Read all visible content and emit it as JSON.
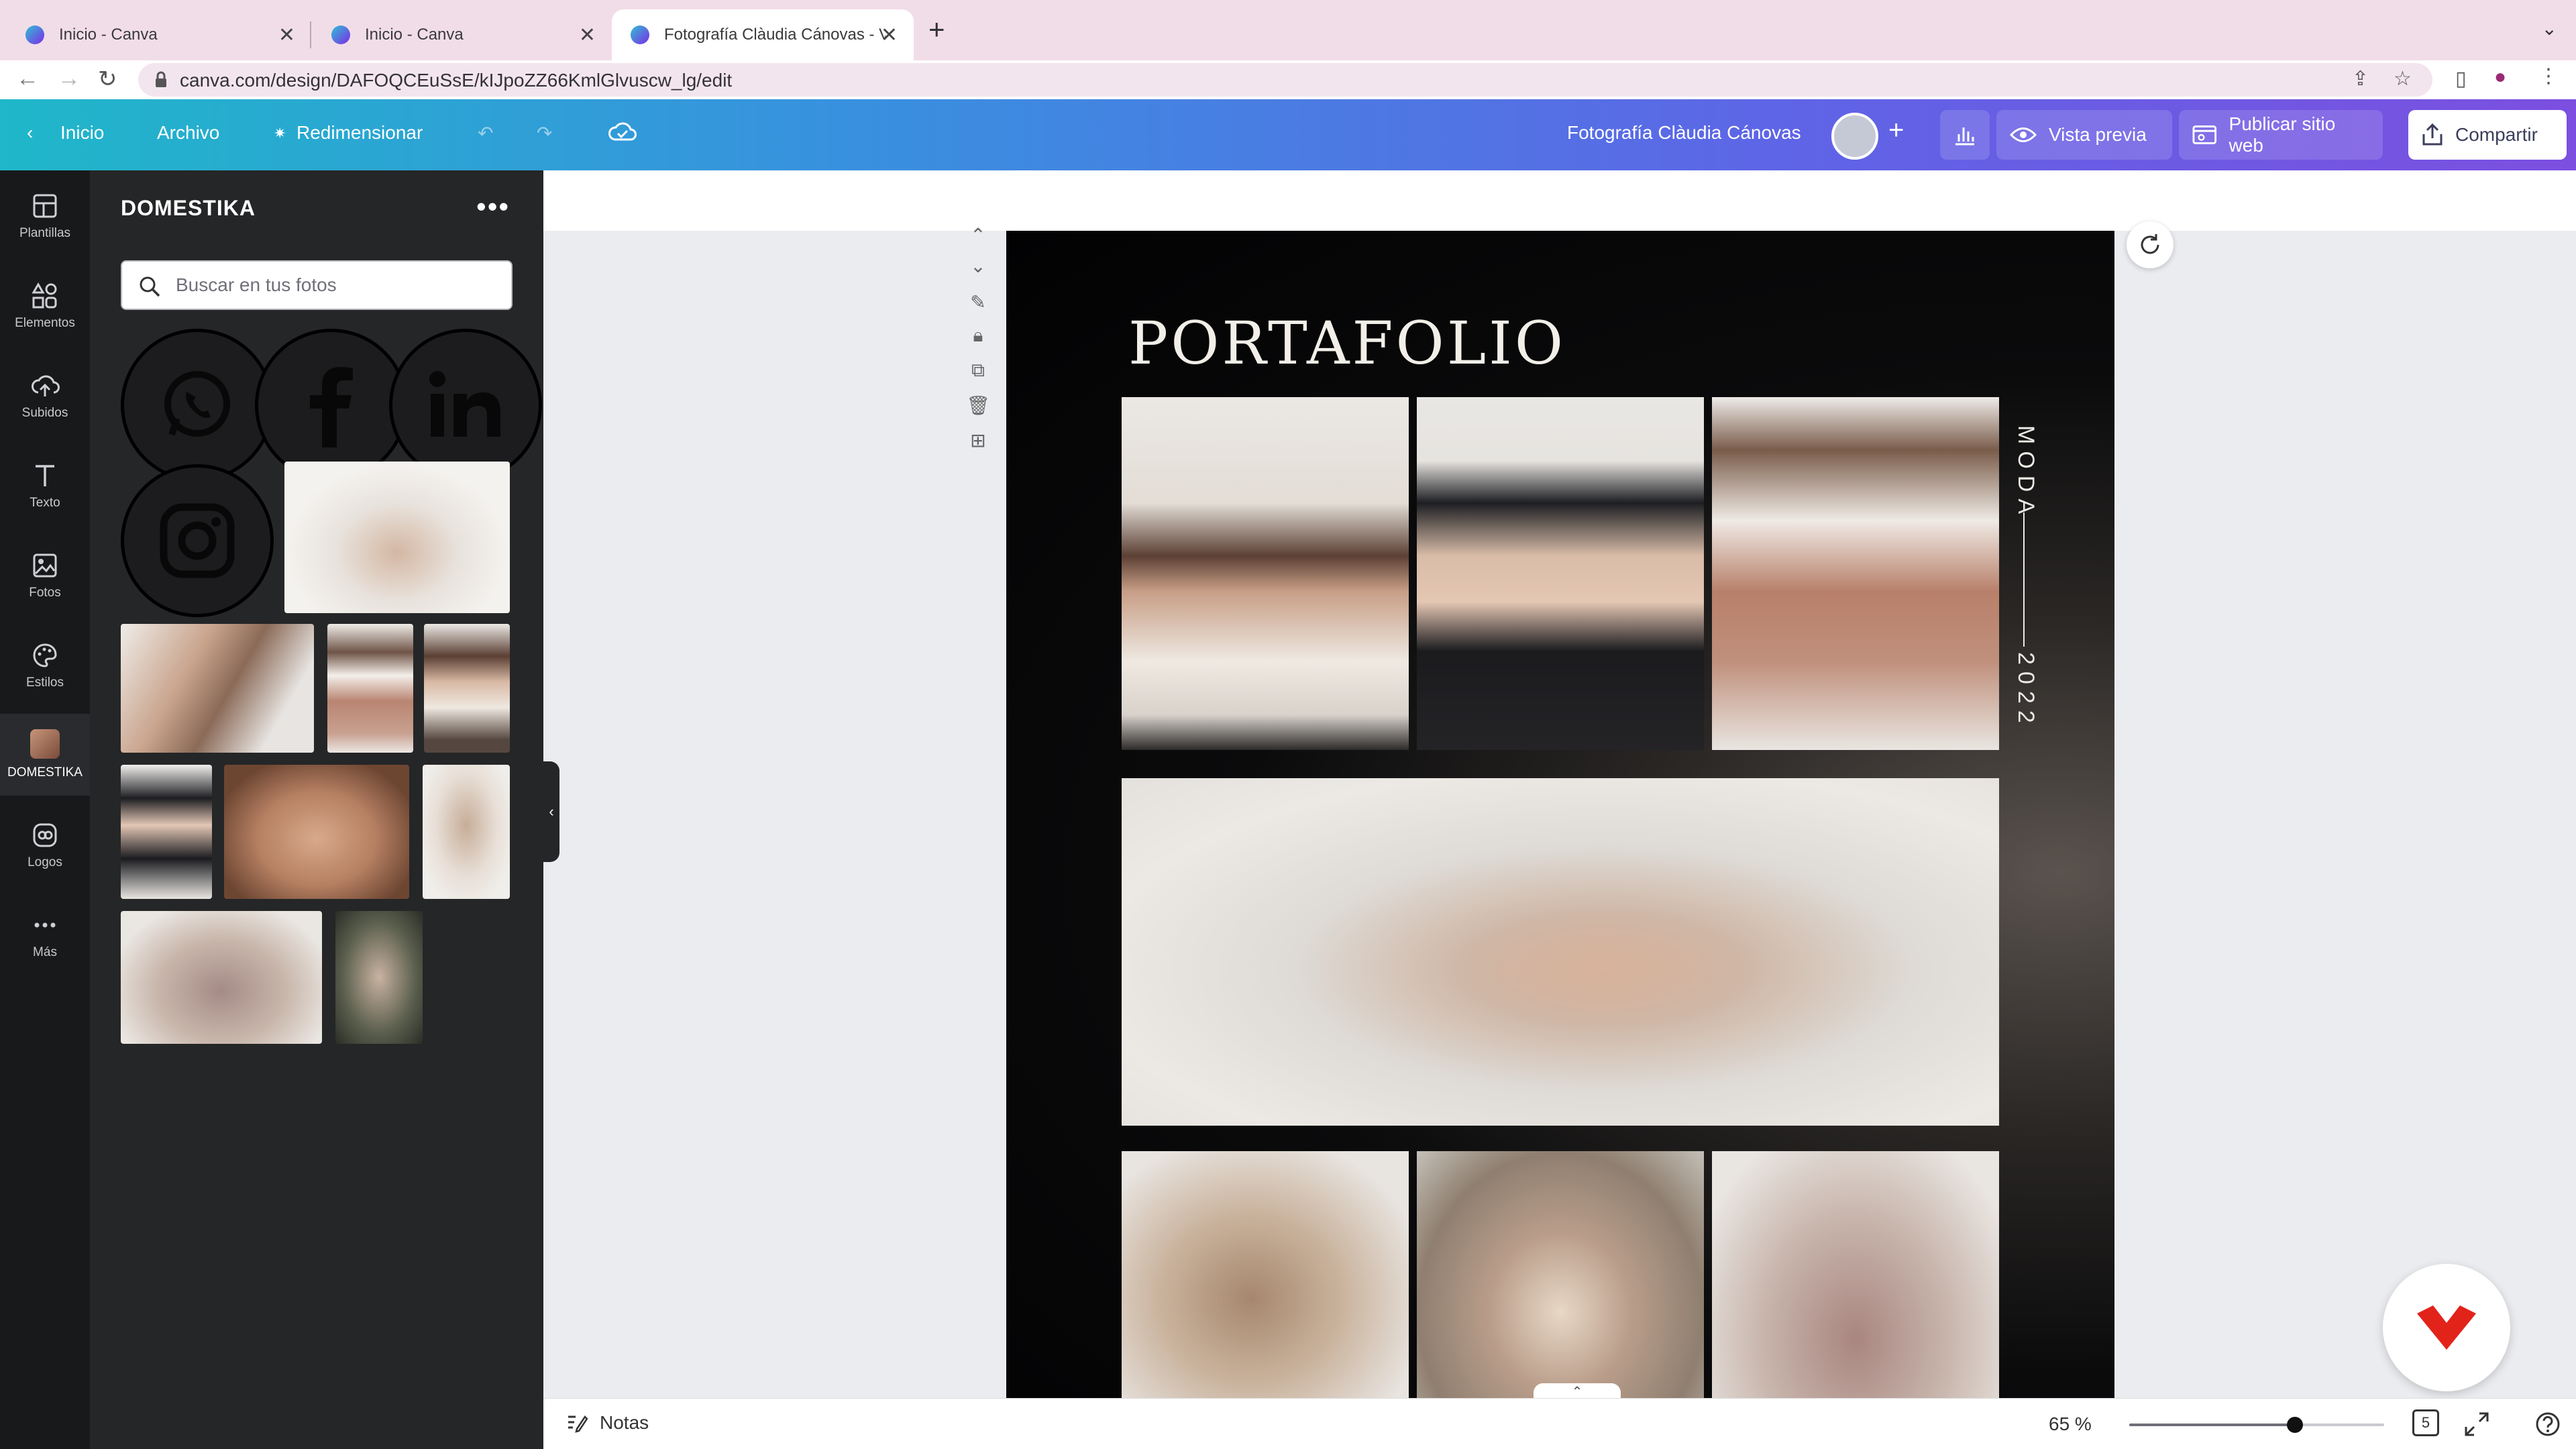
{
  "browser": {
    "tabs": [
      {
        "title": "Inicio - Canva"
      },
      {
        "title": "Inicio - Canva"
      },
      {
        "title": "Fotografía Clàudia Cánovas - V"
      }
    ],
    "url": "canva.com/design/DAFOQCEuSsE/kIJpoZZ66KmlGlvuscw_lg/edit"
  },
  "topbar": {
    "home": "Inicio",
    "file": "Archivo",
    "resize": "Redimensionar",
    "design_title": "Fotografía Clàudia Cánovas",
    "preview": "Vista previa",
    "publish": "Publicar sitio web",
    "share": "Compartir"
  },
  "rail": {
    "items": [
      {
        "label": "Plantillas",
        "icon": "templates-icon"
      },
      {
        "label": "Elementos",
        "icon": "elements-icon"
      },
      {
        "label": "Subidos",
        "icon": "uploads-icon"
      },
      {
        "label": "Texto",
        "icon": "text-icon"
      },
      {
        "label": "Fotos",
        "icon": "photos-icon"
      },
      {
        "label": "Estilos",
        "icon": "styles-icon"
      },
      {
        "label": "DOMESTIKA",
        "icon": "domestika-thumb"
      },
      {
        "label": "Logos",
        "icon": "logos-icon"
      },
      {
        "label": "Más",
        "icon": "more-icon"
      }
    ]
  },
  "panel": {
    "title": "DOMESTIKA",
    "search_placeholder": "Buscar en tus fotos",
    "social_icons": [
      "whatsapp-icon",
      "facebook-icon",
      "linkedin-icon",
      "instagram-icon"
    ]
  },
  "design": {
    "title": "PORTAFOLIO",
    "side_label": "MODA",
    "year": "2022"
  },
  "bottombar": {
    "notes": "Notas",
    "zoom": "65 %",
    "zoom_level": 0.65,
    "pages": "5"
  },
  "colors": {
    "brand_gradient_start": "#1fb7c9",
    "brand_gradient_end": "#7c4fe0",
    "panel_bg": "#252627",
    "rail_bg": "#18191b",
    "domestika_red": "#e2231a"
  }
}
